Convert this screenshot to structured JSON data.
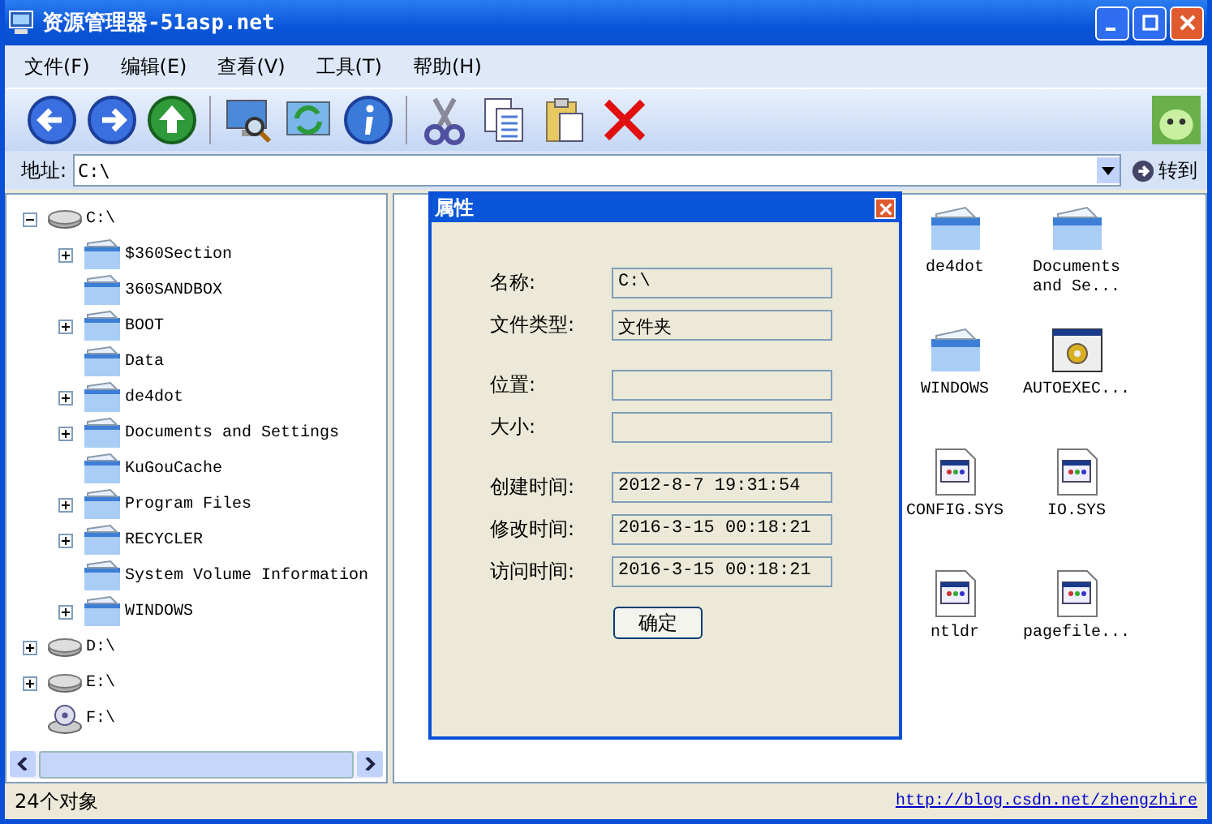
{
  "window": {
    "title": "资源管理器-51asp.net"
  },
  "menu": [
    "文件(F)",
    "编辑(E)",
    "查看(V)",
    "工具(T)",
    "帮助(H)"
  ],
  "address": {
    "label": "地址:",
    "value": "C:\\",
    "go": "转到"
  },
  "tree": [
    {
      "label": "C:\\",
      "kind": "drive",
      "has_children": true,
      "expanded": true,
      "children": [
        {
          "label": "$360Section",
          "kind": "folder",
          "has_children": true,
          "expanded": false
        },
        {
          "label": "360SANDBOX",
          "kind": "folder",
          "has_children": false
        },
        {
          "label": "BOOT",
          "kind": "folder",
          "has_children": true,
          "expanded": false
        },
        {
          "label": "Data",
          "kind": "folder",
          "has_children": false
        },
        {
          "label": "de4dot",
          "kind": "folder",
          "has_children": true,
          "expanded": false
        },
        {
          "label": "Documents and Settings",
          "kind": "folder",
          "has_children": true,
          "expanded": false
        },
        {
          "label": "KuGouCache",
          "kind": "folder",
          "has_children": false
        },
        {
          "label": "Program Files",
          "kind": "folder",
          "has_children": true,
          "expanded": false
        },
        {
          "label": "RECYCLER",
          "kind": "folder",
          "has_children": true,
          "expanded": false
        },
        {
          "label": "System Volume Information",
          "kind": "folder",
          "has_children": false
        },
        {
          "label": "WINDOWS",
          "kind": "folder",
          "has_children": true,
          "expanded": false
        }
      ]
    },
    {
      "label": "D:\\",
      "kind": "drive",
      "has_children": true,
      "expanded": false
    },
    {
      "label": "E:\\",
      "kind": "drive",
      "has_children": true,
      "expanded": false
    },
    {
      "label": "F:\\",
      "kind": "cdrom",
      "has_children": false
    }
  ],
  "files": [
    {
      "name": "de4dot",
      "kind": "folder"
    },
    {
      "name": "Documents and Se...",
      "kind": "folder"
    },
    {
      "name": "WINDOWS",
      "kind": "folder"
    },
    {
      "name": "AUTOEXEC...",
      "kind": "batch"
    },
    {
      "name": "CONFIG.SYS",
      "kind": "system"
    },
    {
      "name": "IO.SYS",
      "kind": "system"
    },
    {
      "name": "ntldr",
      "kind": "system"
    },
    {
      "name": "pagefile...",
      "kind": "system"
    }
  ],
  "dialog": {
    "title": "属性",
    "groups": [
      [
        {
          "label": "名称:",
          "value": "C:\\"
        },
        {
          "label": "文件类型:",
          "value": "文件夹"
        }
      ],
      [
        {
          "label": "位置:"
        },
        {
          "label": "大小:"
        }
      ],
      [
        {
          "label": "创建时间:",
          "value": "2012-8-7 19:31:54"
        },
        {
          "label": "修改时间:",
          "value": "2016-3-15 00:18:21"
        },
        {
          "label": "访问时间:",
          "value": "2016-3-15 00:18:21"
        }
      ]
    ],
    "ok": "确定"
  },
  "status_bar": {
    "count": "24个对象",
    "link": "http://blog.csdn.net/zhengzhire"
  }
}
